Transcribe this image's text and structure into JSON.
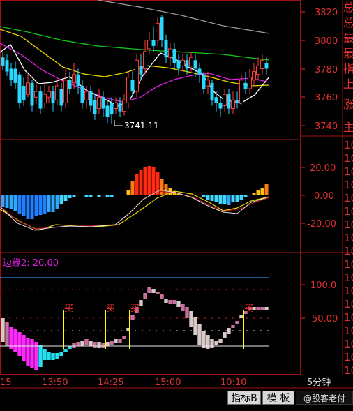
{
  "colors": {
    "bg": "#000000",
    "frame": "#a01010",
    "axis_text": "#e03030",
    "up_candle": "#ff3b3b",
    "down_candle": "#29d7ff",
    "ma_white": "#ffffff",
    "ma_yellow": "#e8d800",
    "ma_green": "#16c816",
    "ma_magenta": "#e020e0",
    "ma_gray": "#9a9aa0",
    "bar_line": "#2a8fe8",
    "signal_line": "#ffff00",
    "kdj_pink": "#c86fa0",
    "kdj_light": "#d8c8c8",
    "kdj_magenta": "#ff28ff",
    "kdj_cyan": "#24e0f0"
  },
  "main_chart": {
    "y_ticks": [
      "3820",
      "3800",
      "3780",
      "3760",
      "3740"
    ],
    "low_marker": "3741.11"
  },
  "macd_panel": {
    "y_ticks": [
      "20.00",
      "0.00",
      "-20.00"
    ]
  },
  "indicator_panel": {
    "label": "边缘2: 20.00",
    "y_ticks": [
      "100.0",
      "50.00"
    ],
    "buy_label": "买"
  },
  "right_info": {
    "chars": [
      "总",
      "总",
      "最",
      "最",
      "指",
      "上",
      "涨",
      "主"
    ],
    "numeric_stubs": [
      "10",
      "10",
      "10",
      "10",
      "10",
      "10",
      "10",
      "10",
      "10",
      "10",
      "10",
      "10",
      "10",
      "10",
      "10",
      "10",
      "10",
      "10"
    ]
  },
  "time_axis": {
    "labels": [
      "15",
      "13:50",
      "14:25",
      "15:00",
      "10:10"
    ],
    "period": "5分钟"
  },
  "bottom_bar": {
    "tabs": [
      "指标B",
      "模 板",
      "5分钟"
    ],
    "watermark": "@股客老付"
  }
}
